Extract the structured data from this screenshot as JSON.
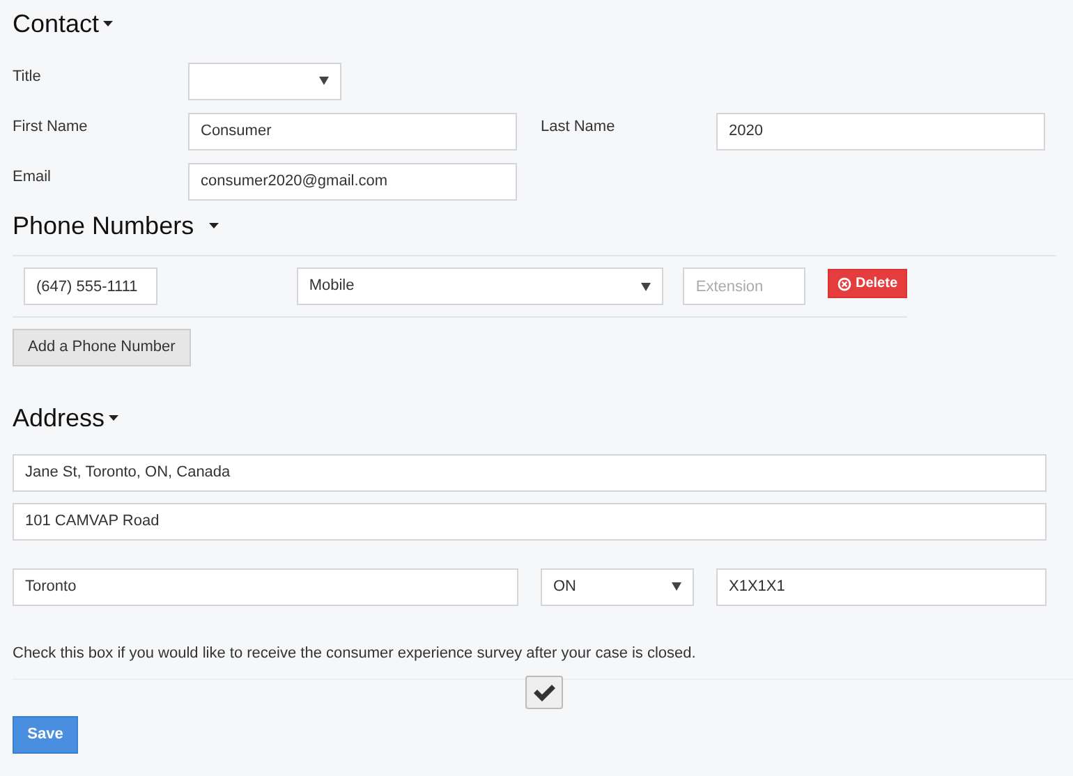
{
  "contact": {
    "heading": "Contact",
    "rows": [
      [
        {
          "label": "Title",
          "kind": "select"
        }
      ],
      [
        {
          "label": "First Name",
          "kind": "text",
          "value": "Consumer"
        },
        {
          "label": "Last Name",
          "kind": "text",
          "value": "2020"
        }
      ],
      [
        {
          "label": "Email",
          "kind": "text",
          "value": "consumer2020@gmail.com"
        }
      ]
    ]
  },
  "phone": {
    "heading": "Phone Numbers",
    "numbers": [
      {
        "number": "(647) 555-1111",
        "type": "Mobile",
        "extension_placeholder": "Extension",
        "delete_button": "Delete"
      }
    ],
    "add_button": "Add a Phone Number"
  },
  "address": {
    "heading": "Address",
    "lines": [
      "Jane St, Toronto, ON, Canada",
      "101 CAMVAP Road"
    ],
    "city": "Toronto",
    "province": "ON",
    "postal_code": "X1X1X1"
  },
  "survey": {
    "text": "Check this box if you would like to receive the consumer experience survey after your case is closed.",
    "checked": true
  },
  "save_button": "Save"
}
